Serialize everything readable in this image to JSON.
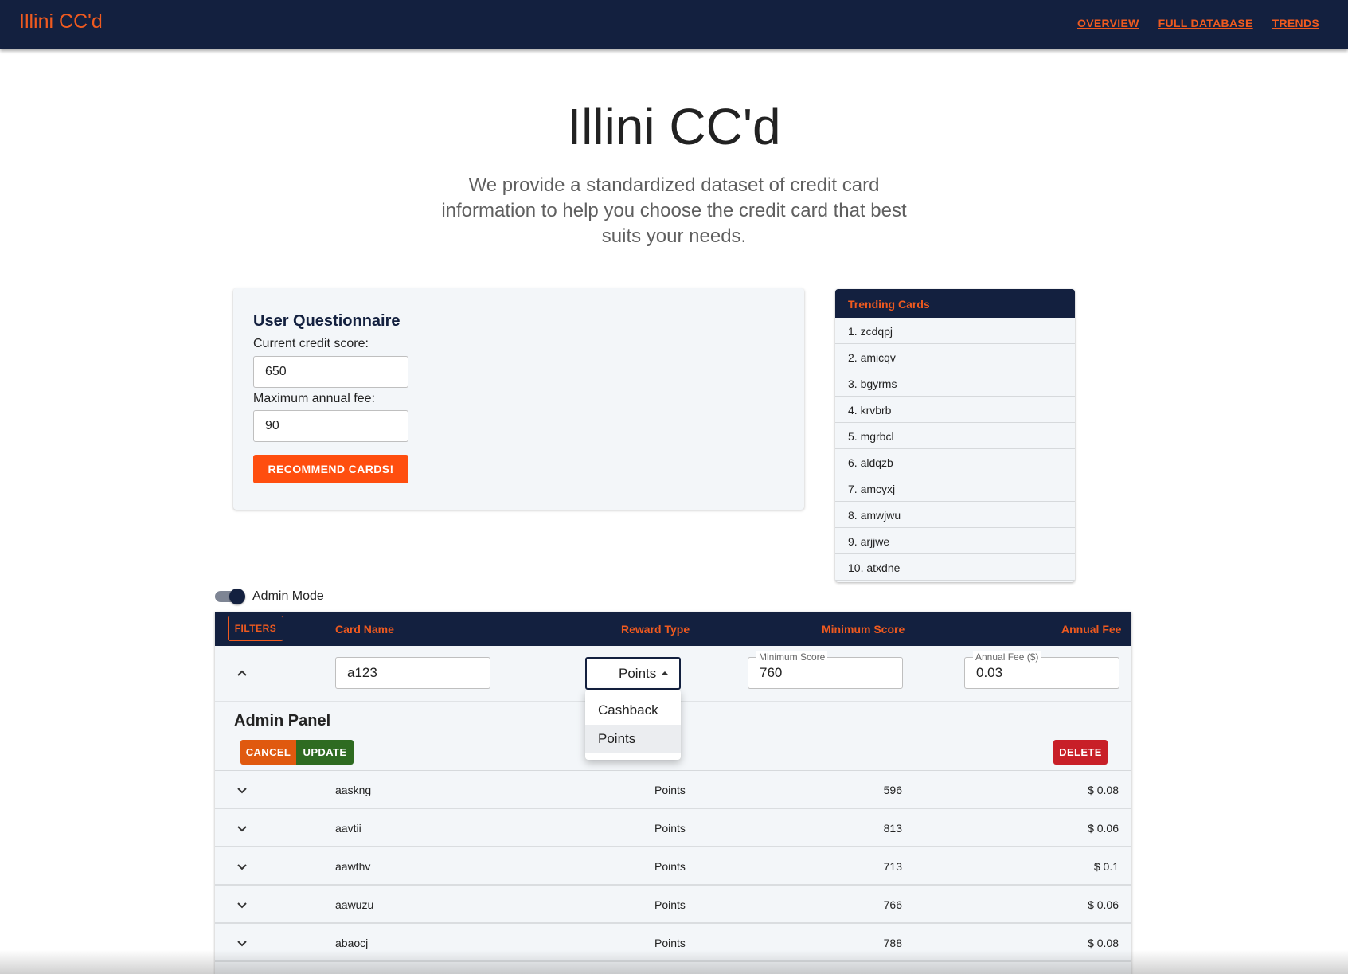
{
  "app": {
    "brand": "Illini CC'd"
  },
  "nav": {
    "items": [
      "OVERVIEW",
      "FULL DATABASE",
      "TRENDS"
    ]
  },
  "hero": {
    "title": "Illini CC'd",
    "subtitle": "We provide a standardized dataset of credit card information to help you choose the credit card that best suits your needs."
  },
  "questionnaire": {
    "title": "User Questionnaire",
    "credit_label": "Current credit score:",
    "credit_value": "650",
    "fee_label": "Maximum annual fee:",
    "fee_value": "90",
    "button": "RECOMMEND CARDS!"
  },
  "trending": {
    "title": "Trending Cards",
    "items": [
      "1. zcdqpj",
      "2. amicqv",
      "3. bgyrms",
      "4. krvbrb",
      "5. mgrbcl",
      "6. aldqzb",
      "7. amcyxj",
      "8. amwjwu",
      "9. arjjwe",
      "10. atxdne"
    ]
  },
  "admin_mode": {
    "label": "Admin Mode",
    "enabled": true
  },
  "table": {
    "filters_button": "FILTERS",
    "headers": {
      "name": "Card Name",
      "reward": "Reward Type",
      "score": "Minimum Score",
      "fee": "Annual Fee"
    },
    "edit": {
      "name_value": "a123",
      "reward_value": "Points",
      "score_label": "Minimum Score",
      "score_value": "760",
      "fee_label": "Annual Fee ($)",
      "fee_value": "0.03"
    },
    "admin_panel": {
      "title": "Admin Panel",
      "cancel": "CANCEL",
      "update": "UPDATE",
      "delete": "DELETE"
    },
    "rows": [
      {
        "name": "aaskng",
        "reward": "Points",
        "score": "596",
        "fee": "$ 0.08"
      },
      {
        "name": "aavtii",
        "reward": "Points",
        "score": "813",
        "fee": "$ 0.06"
      },
      {
        "name": "aawthv",
        "reward": "Points",
        "score": "713",
        "fee": "$ 0.1"
      },
      {
        "name": "aawuzu",
        "reward": "Points",
        "score": "766",
        "fee": "$ 0.06"
      },
      {
        "name": "abaocj",
        "reward": "Points",
        "score": "788",
        "fee": "$ 0.08"
      }
    ]
  },
  "reward_menu": {
    "options": [
      "Cashback",
      "Points"
    ],
    "selected": "Points"
  },
  "colors": {
    "navy": "#13203f",
    "accent": "#ef5a1f",
    "cancel": "#e0590f",
    "update": "#2e6b21",
    "delete": "#c81f28"
  }
}
